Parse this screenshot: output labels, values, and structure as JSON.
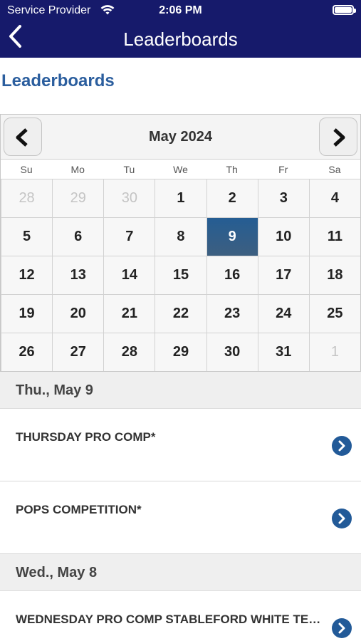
{
  "status_bar": {
    "carrier": "Service Provider",
    "time": "2:06 PM"
  },
  "nav": {
    "title": "Leaderboards",
    "back_icon": "chevron-left-icon"
  },
  "page": {
    "heading": "Leaderboards"
  },
  "calendar": {
    "month_label": "May 2024",
    "weekdays": [
      "Su",
      "Mo",
      "Tu",
      "We",
      "Th",
      "Fr",
      "Sa"
    ],
    "days": [
      {
        "label": "28",
        "muted": true
      },
      {
        "label": "29",
        "muted": true
      },
      {
        "label": "30",
        "muted": true
      },
      {
        "label": "1"
      },
      {
        "label": "2"
      },
      {
        "label": "3"
      },
      {
        "label": "4"
      },
      {
        "label": "5"
      },
      {
        "label": "6"
      },
      {
        "label": "7"
      },
      {
        "label": "8"
      },
      {
        "label": "9",
        "selected": true
      },
      {
        "label": "10"
      },
      {
        "label": "11"
      },
      {
        "label": "12"
      },
      {
        "label": "13"
      },
      {
        "label": "14"
      },
      {
        "label": "15"
      },
      {
        "label": "16"
      },
      {
        "label": "17"
      },
      {
        "label": "18"
      },
      {
        "label": "19"
      },
      {
        "label": "20"
      },
      {
        "label": "21"
      },
      {
        "label": "22"
      },
      {
        "label": "23"
      },
      {
        "label": "24"
      },
      {
        "label": "25"
      },
      {
        "label": "26"
      },
      {
        "label": "27"
      },
      {
        "label": "28"
      },
      {
        "label": "29"
      },
      {
        "label": "30"
      },
      {
        "label": "31"
      },
      {
        "label": "1",
        "muted": true
      }
    ],
    "selected_color": "#255d93"
  },
  "sections": [
    {
      "header": "Thu., May 9",
      "events": [
        "THURSDAY PRO COMP*",
        "POPS COMPETITION*"
      ]
    },
    {
      "header": "Wed., May 8",
      "events": [
        "WEDNESDAY PRO COMP STABLEFORD WHITE TEES*"
      ]
    }
  ],
  "colors": {
    "nav_background": "#161a6b",
    "heading": "#2b5e9e",
    "chevron_button": "#225a98"
  }
}
